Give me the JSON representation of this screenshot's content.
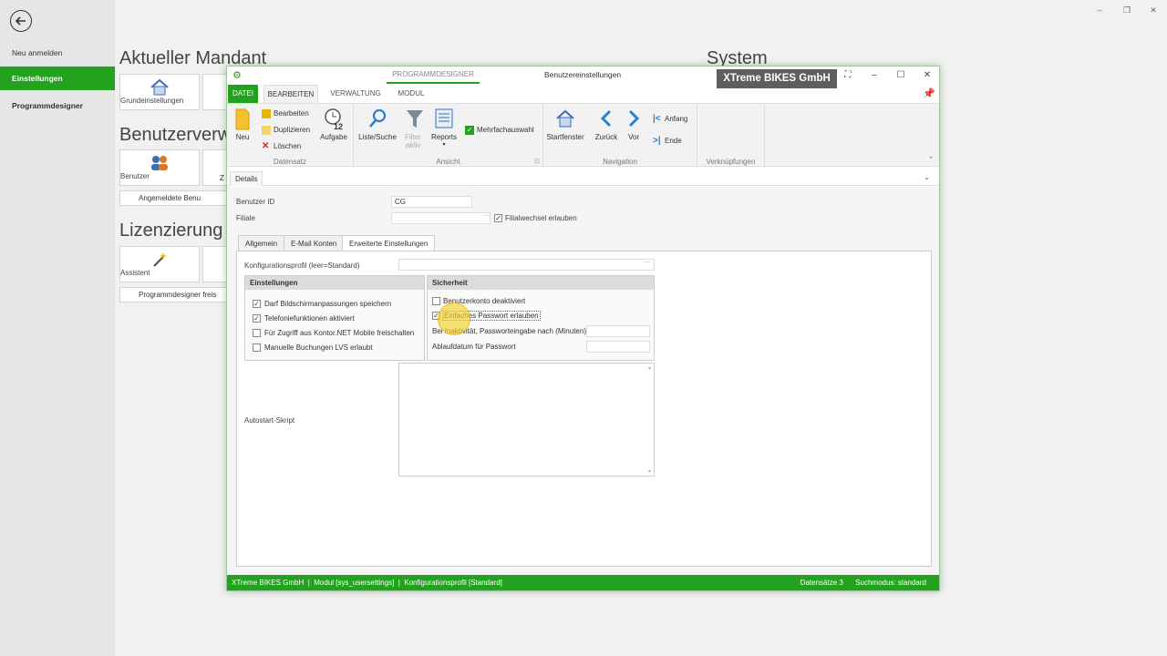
{
  "leftnav": {
    "items": [
      "Neu anmelden",
      "Einstellungen",
      "Programmdesigner"
    ]
  },
  "window_controls": {
    "minimize": "‒",
    "restore": "❐",
    "close": "✕"
  },
  "background": {
    "section1": "Aktueller Mandant",
    "section2": "Benutzerverw",
    "section3": "Lizenzierung",
    "section4": "System",
    "tiles": [
      "Grundeinstellungen",
      "Benutzer",
      "Z",
      "Assistent"
    ],
    "wide_buttons": [
      "Angemeldete Benu",
      "Programmdesigner freis"
    ]
  },
  "dialog": {
    "context_tab": "PROGRAMMDESIGNER",
    "title": "Benutzereinstellungen",
    "company_badge": "XTreme BIKES GmbH",
    "ribbon_tabs": [
      "DATEI",
      "BEARBEITEN",
      "VERWALTUNG",
      "MODUL"
    ],
    "ribbon": {
      "datensatz": {
        "label": "Datensatz",
        "neu": "Neu",
        "bearbeiten": "Bearbeiten",
        "duplizieren": "Duplizieren",
        "loeschen": "Löschen",
        "aufgabe": "Aufgabe",
        "aufgabe_badge": "12"
      },
      "ansicht": {
        "label": "Ansicht",
        "liste": "Liste/Suche",
        "filter": "Filter aktiv",
        "reports": "Reports",
        "mehrfach": "Mehrfachauswahl"
      },
      "navigation": {
        "label": "Navigation",
        "startfenster": "Startfenster",
        "zurueck": "Zurück",
        "vor": "Vor",
        "anfang": "Anfang",
        "ende": "Ende"
      },
      "verknuepfungen": {
        "label": "Verknüpfungen"
      }
    },
    "details_tab": "Details",
    "form": {
      "benutzer_id_label": "Benutzer ID",
      "benutzer_id_value": "CG",
      "filiale_label": "Filiale",
      "filiale_value": "",
      "filialwechsel_label": "Filialwechsel erlauben",
      "filialwechsel_checked": true
    },
    "tabs": [
      "Allgemein",
      "E-Mail Konten",
      "Erweiterte Einstellungen"
    ],
    "erweitert": {
      "profil_label": "Konfigurationsprofil (leer=Standard)",
      "profil_value": "",
      "einstellungen_head": "Einstellungen",
      "einstellungen": [
        {
          "label": "Darf Bildschirmanpassungen speichern",
          "checked": true
        },
        {
          "label": "Telefoniefunktionen aktiviert",
          "checked": true
        },
        {
          "label": "Für Zugriff aus Kontor.NET Mobile freischalten",
          "checked": false
        },
        {
          "label": "Manuelle Buchungen LVS erlaubt",
          "checked": false
        }
      ],
      "sicherheit_head": "Sicherheit",
      "sicherheit": [
        {
          "label": "Benutzerkonto deaktiviert",
          "checked": false
        },
        {
          "label": "Einfaches Passwort erlauben",
          "checked": true
        }
      ],
      "inaktivitaet_label": "Bei Inaktivität, Passworteingabe nach (Minuten)",
      "ablauf_label": "Ablaufdatum für Passwort",
      "autostart_label": "Autostart-Skript"
    },
    "status": {
      "company": "XTreme BIKES GmbH",
      "modul": "Modul [sys_usersettings]",
      "profil": "Konfigurationsprofil [Standard]",
      "datensaetze": "Datensätze 3",
      "suchmodus": "Suchmodus: standard"
    }
  },
  "colors": {
    "accent": "#22a21e",
    "badge": "#5e5e5e"
  }
}
